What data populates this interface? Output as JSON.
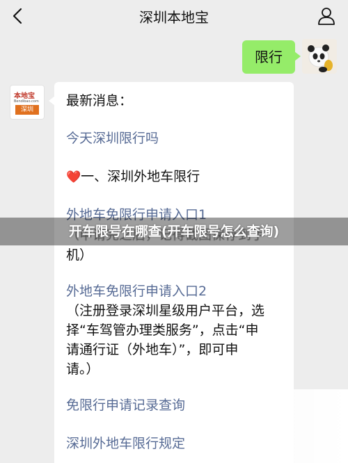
{
  "header": {
    "title": "深圳本地宝",
    "back_icon": "chevron-left-icon",
    "profile_icon": "person-icon"
  },
  "outgoing": {
    "text": "限行"
  },
  "bot": {
    "logo_text": "本地宝",
    "logo_sub": "Bendibao.com",
    "logo_badge": "深圳"
  },
  "message": {
    "heading": "最新消息：",
    "link_today": "今天深圳限行吗",
    "section_one": "一、深圳外地车限行",
    "link_apply": "外地车免限行申请入口1",
    "note1_line1": "（申请完之后，记得截图保存到手",
    "note1_line2": "机）",
    "link_apply2": "外地车免限行申请入口2",
    "note2_line1": "（注册登录深圳星级用户平台，选",
    "note2_line2": "择“车驾管办理类服务”，点击“申",
    "note2_line3": "请通行证（外地车）”，即可申",
    "note2_line4": "请。）",
    "link_records": "免限行申请记录查询",
    "link_rules": "深圳外地车限行规定"
  },
  "overlay": {
    "caption": "开车限号在哪查(开车限号怎么查询)"
  },
  "colors": {
    "link": "#576b95",
    "green_bubble": "#95ec69",
    "background": "#ededed",
    "heart": "#e03040"
  }
}
